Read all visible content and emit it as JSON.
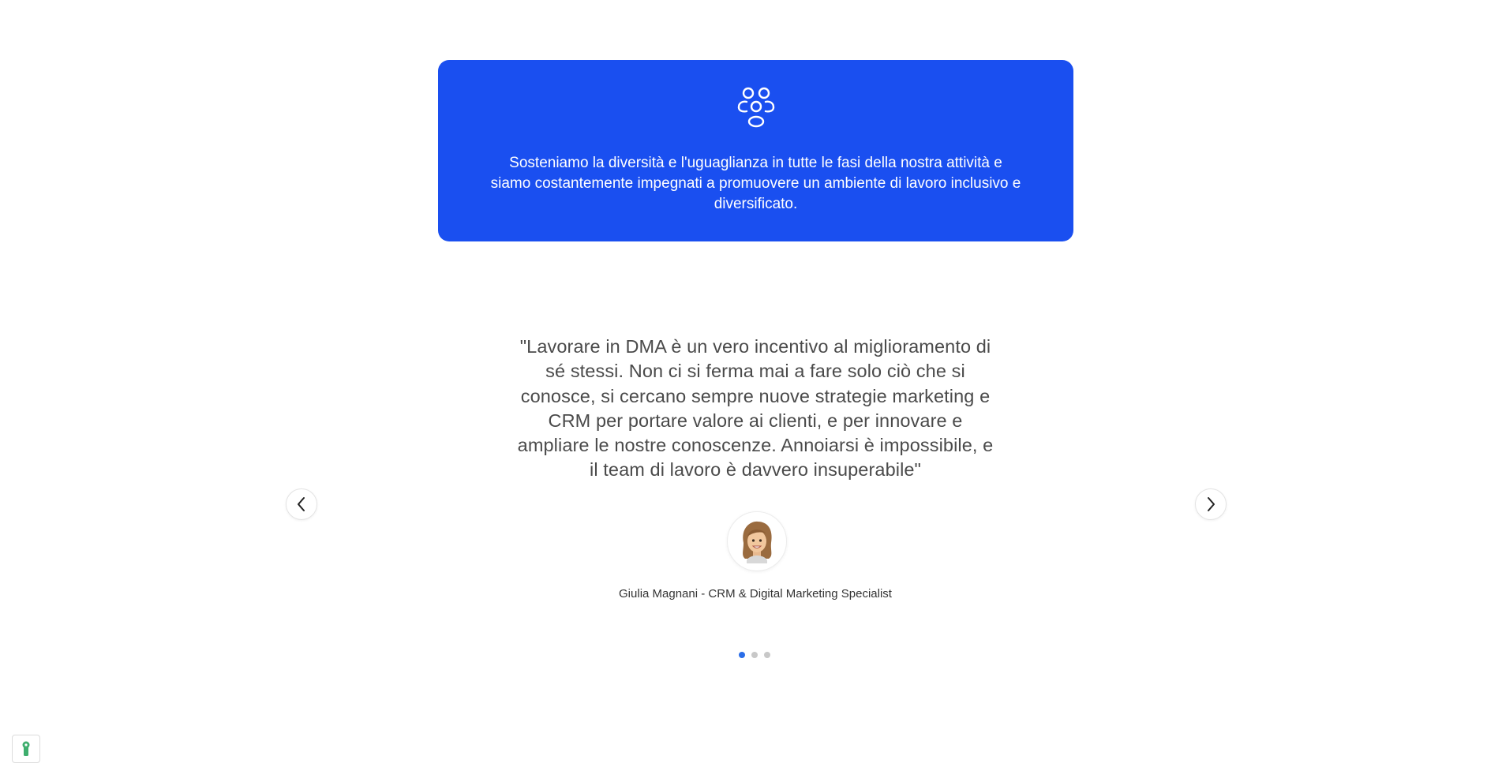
{
  "values_card": {
    "icon": "people-group-icon",
    "text": "Sosteniamo la diversità e l'uguaglianza in tutte le fasi della nostra attività e siamo costantemente impegnati a promuovere un ambiente di lavoro inclusivo e diversificato.",
    "background": "#1a4ff0"
  },
  "testimonial": {
    "quote": "\"Lavorare in DMA è un vero incentivo al miglioramento di sé stessi. Non ci si ferma mai a fare solo ciò che si conosce, si cercano sempre nuove strategie marketing e CRM per portare valore ai clienti, e per innovare e ampliare le nostre conoscenze. Annoiarsi è impossibile, e il team di lavoro è davvero insuperabile\"",
    "author": "Giulia Magnani - CRM & Digital Marketing Specialist",
    "avatar_icon": "memoji-avatar-icon"
  },
  "carousel": {
    "prev_icon": "chevron-left-icon",
    "next_icon": "chevron-right-icon",
    "slides": 3,
    "active_index": 0,
    "active_color": "#2b6ee8"
  },
  "cookie_widget": {
    "icon": "cookie-keyhole-icon",
    "color": "#3fae6e"
  }
}
